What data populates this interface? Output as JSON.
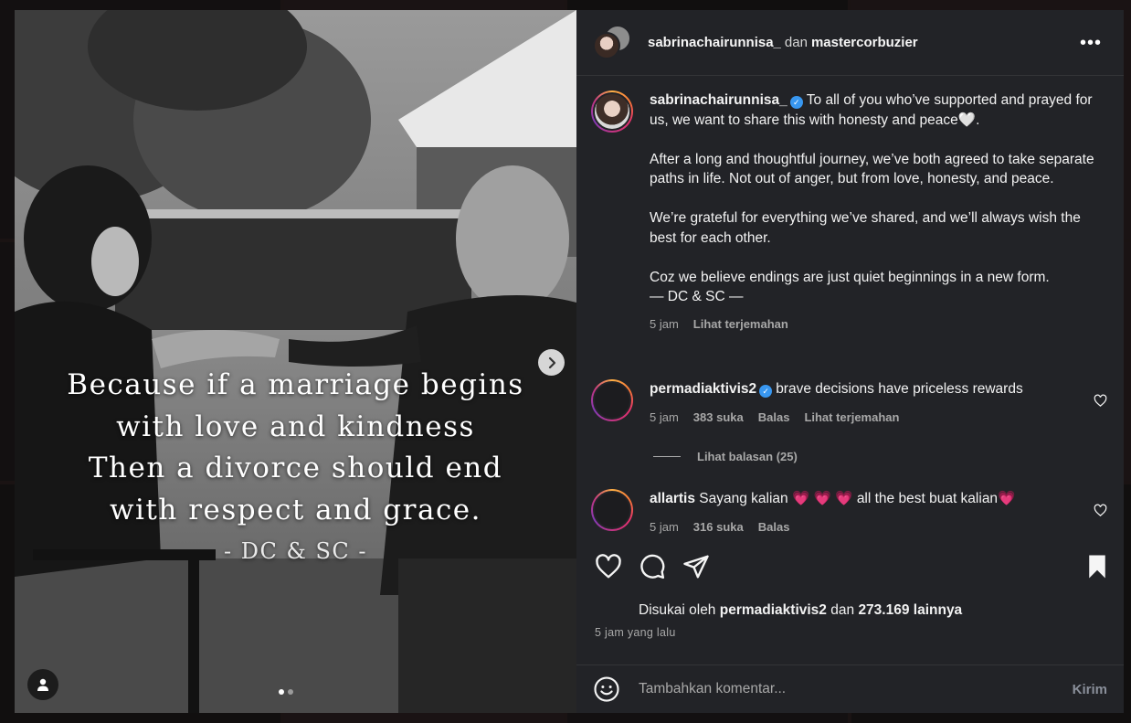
{
  "post": {
    "overlay_lines": [
      "Because if a marriage begins",
      "with love and kindness",
      "Then a divorce should end",
      "with respect and grace."
    ],
    "overlay_sign": "- DC & SC -",
    "next_icon": "chevron-right-icon",
    "tag_icon": "user-tag-icon"
  },
  "header": {
    "user1": "sabrinachairunnisa_",
    "and": "dan",
    "user2": "mastercorbuzier",
    "more_label": "•••"
  },
  "caption": {
    "user": "sabrinachairunnisa_",
    "verified": "✓",
    "line1": "To all of you who’ve supported and prayed for us, we want to share this with honesty and peace",
    "heart": "🤍",
    "line1_end": ".",
    "para2": "After a long and thoughtful journey, we’ve both agreed to take separate paths in life. Not out of anger, but from love, honesty, and peace.",
    "para3": "We’re grateful for everything we’ve shared, and we’ll always wish the best for each other.",
    "para4": "Coz we believe endings are just quiet beginnings in a new form.",
    "signature": "— DC & SC —",
    "time": "5 jam",
    "translate": "Lihat terjemahan"
  },
  "comments": [
    {
      "user": "permadiaktivis2",
      "verified": "✓",
      "text": "brave decisions have priceless rewards",
      "time": "5 jam",
      "likes": "383 suka",
      "reply": "Balas",
      "translate": "Lihat terjemahan",
      "view_replies": "Lihat balasan (25)"
    },
    {
      "user": "allartis",
      "text": "Sayang kalian",
      "hearts": "💗 💗 💗",
      "text2": "all the best buat kalian",
      "heart_end": "💗",
      "time": "5 jam",
      "likes": "316 suka",
      "reply": "Balas"
    }
  ],
  "likes": {
    "prefix": "Disukai oleh",
    "user": "permadiaktivis2",
    "and": "dan",
    "others": "273.169 lainnya"
  },
  "time_ago": "5 jam yang lalu",
  "add_comment": {
    "placeholder": "Tambahkan komentar...",
    "send": "Kirim"
  },
  "colors": {
    "panel_bg": "#222327",
    "muted_text": "#a8a8a8",
    "verified_blue": "#3897f0"
  }
}
